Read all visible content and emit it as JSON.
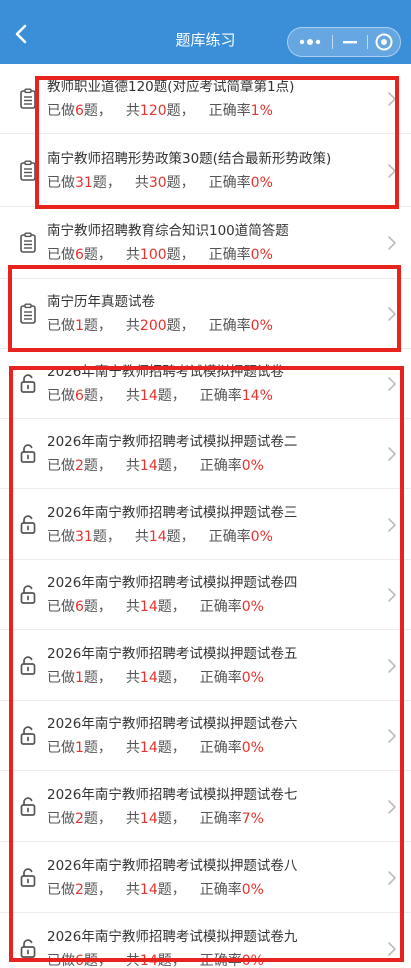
{
  "header": {
    "title": "题库练习",
    "bg_color": "#3b8fd9"
  },
  "stats_labels": {
    "done_prefix": "已做",
    "done_suffix": "题，",
    "total_prefix": "共",
    "total_suffix": "题，",
    "rate_prefix": "正确率",
    "rate_suffix": "%"
  },
  "items": [
    {
      "title": "教师职业道德120题(对应考试简章第1点)",
      "done": "6",
      "total": "120",
      "rate": "1",
      "icon": "document-icon"
    },
    {
      "title": "南宁教师招聘形势政策30题(结合最新形势政策)",
      "done": "31",
      "total": "30",
      "rate": "0",
      "icon": "document-icon"
    },
    {
      "title": "南宁教师招聘教育综合知识100道简答题",
      "done": "6",
      "total": "100",
      "rate": "0",
      "icon": "document-icon"
    },
    {
      "title": "南宁历年真题试卷",
      "done": "1",
      "total": "200",
      "rate": "0",
      "icon": "document-icon"
    },
    {
      "title": "2026年南宁教师招聘考试模拟押题试卷",
      "done": "6",
      "total": "14",
      "rate": "14",
      "icon": "unlock-icon"
    },
    {
      "title": "2026年南宁教师招聘考试模拟押题试卷二",
      "done": "2",
      "total": "14",
      "rate": "0",
      "icon": "unlock-icon"
    },
    {
      "title": "2026年南宁教师招聘考试模拟押题试卷三",
      "done": "31",
      "total": "14",
      "rate": "0",
      "icon": "unlock-icon"
    },
    {
      "title": "2026年南宁教师招聘考试模拟押题试卷四",
      "done": "6",
      "total": "14",
      "rate": "0",
      "icon": "unlock-icon"
    },
    {
      "title": "2026年南宁教师招聘考试模拟押题试卷五",
      "done": "1",
      "total": "14",
      "rate": "0",
      "icon": "unlock-icon"
    },
    {
      "title": "2026年南宁教师招聘考试模拟押题试卷六",
      "done": "1",
      "total": "14",
      "rate": "0",
      "icon": "unlock-icon"
    },
    {
      "title": "2026年南宁教师招聘考试模拟押题试卷七",
      "done": "2",
      "total": "14",
      "rate": "7",
      "icon": "unlock-icon"
    },
    {
      "title": "2026年南宁教师招聘考试模拟押题试卷八",
      "done": "2",
      "total": "14",
      "rate": "0",
      "icon": "unlock-icon"
    },
    {
      "title": "2026年南宁教师招聘考试模拟押题试卷九",
      "done": "6",
      "total": "14",
      "rate": "0",
      "icon": "unlock-icon"
    }
  ],
  "colors": {
    "accent_red": "#e8322e",
    "highlight_border": "#e6231d"
  }
}
